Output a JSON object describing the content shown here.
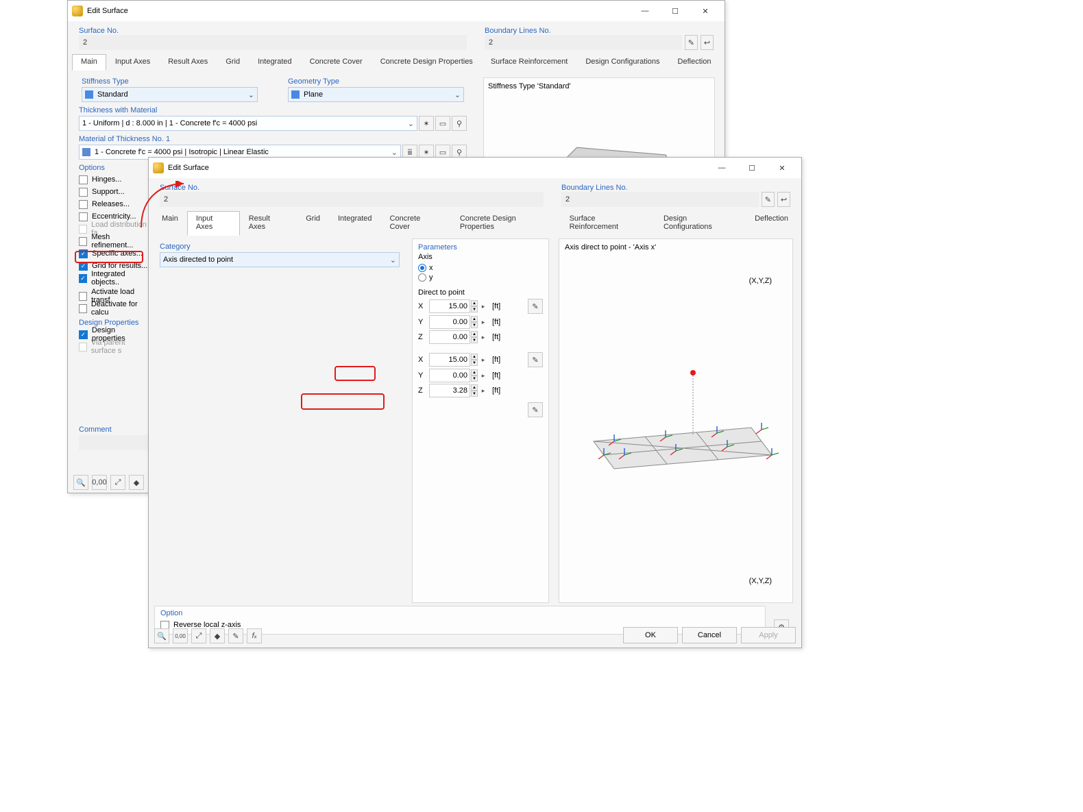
{
  "dialog1": {
    "title": "Edit Surface",
    "surface_no_label": "Surface No.",
    "surface_no": "2",
    "boundary_label": "Boundary Lines No.",
    "boundary": "2",
    "tabs": [
      "Main",
      "Input Axes",
      "Result Axes",
      "Grid",
      "Integrated",
      "Concrete Cover",
      "Concrete Design Properties",
      "Surface Reinforcement",
      "Design Configurations",
      "Deflection"
    ],
    "stiffness_type_label": "Stiffness Type",
    "stiffness_type": "Standard",
    "geometry_type_label": "Geometry Type",
    "geometry_type": "Plane",
    "preview_title": "Stiffness Type 'Standard'",
    "thickness_label": "Thickness with Material",
    "thickness": "1 - Uniform | d : 8.000 in | 1 - Concrete f'c = 4000 psi",
    "material_label": "Material of Thickness No. 1",
    "material": "1 - Concrete f'c = 4000 psi | Isotropic | Linear Elastic",
    "options_label": "Options",
    "options": [
      {
        "label": "Hinges...",
        "on": false,
        "disabled": false
      },
      {
        "label": "Support...",
        "on": false,
        "disabled": false
      },
      {
        "label": "Releases...",
        "on": false,
        "disabled": false
      },
      {
        "label": "Eccentricity...",
        "on": false,
        "disabled": false
      },
      {
        "label": "Load distribution fa",
        "on": false,
        "disabled": true
      },
      {
        "label": "Mesh refinement...",
        "on": false,
        "disabled": false
      },
      {
        "label": "Specific axes...",
        "on": true,
        "disabled": false
      },
      {
        "label": "Grid for results...",
        "on": true,
        "disabled": false
      },
      {
        "label": "Integrated objects..",
        "on": true,
        "disabled": false
      },
      {
        "label": "Activate load transf",
        "on": false,
        "disabled": false
      },
      {
        "label": "Deactivate for calcu",
        "on": false,
        "disabled": false
      }
    ],
    "design_props_label": "Design Properties",
    "design_props": [
      {
        "label": "Design properties",
        "on": true,
        "disabled": false
      },
      {
        "label": "Via parent surface s",
        "on": false,
        "disabled": true
      }
    ],
    "comment_label": "Comment"
  },
  "dialog2": {
    "title": "Edit Surface",
    "surface_no_label": "Surface No.",
    "surface_no": "2",
    "boundary_label": "Boundary Lines No.",
    "boundary": "2",
    "tabs": [
      "Main",
      "Input Axes",
      "Result Axes",
      "Grid",
      "Integrated",
      "Concrete Cover",
      "Concrete Design Properties",
      "Surface Reinforcement",
      "Design Configurations",
      "Deflection"
    ],
    "category_label": "Category",
    "category": "Axis directed to point",
    "parameters_label": "Parameters",
    "axis_label": "Axis",
    "axis_options": [
      "x",
      "y"
    ],
    "direct_to_point_label": "Direct to point",
    "coords1": {
      "X": "15.00",
      "Y": "0.00",
      "Z": "0.00"
    },
    "coords2": {
      "X": "15.00",
      "Y": "0.00",
      "Z": "3.28"
    },
    "unit": "[ft]",
    "preview_title": "Axis direct to point - 'Axis x'",
    "preview_label1": "(X,Y,Z)",
    "preview_label2": "(X,Y,Z)",
    "option_label": "Option",
    "reverse_z": "Reverse local z-axis",
    "buttons": {
      "ok": "OK",
      "cancel": "Cancel",
      "apply": "Apply"
    }
  }
}
